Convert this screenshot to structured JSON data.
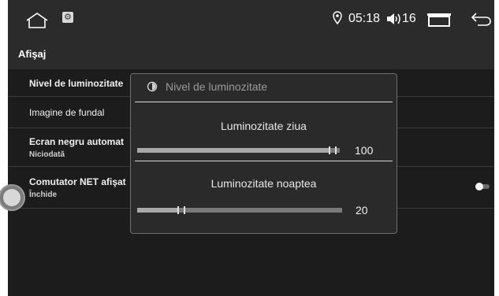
{
  "status_bar": {
    "home_icon": "home-icon",
    "settings_icon": "settings-gear-icon",
    "location_icon": "location-pin-icon",
    "time": "05:18",
    "volume_icon": "volume-icon",
    "volume": "16",
    "recent_icon": "recent-apps-icon",
    "back_icon": "back-arrow-icon"
  },
  "header": {
    "title": "Afişaj"
  },
  "settings_list": [
    {
      "title": "Nivel de luminozitate"
    },
    {
      "title": "Imagine de fundal"
    },
    {
      "title": "Ecran negru automat",
      "subtitle": "Niciodată"
    },
    {
      "title": "Comutator NET afişat",
      "subtitle": "Închide",
      "toggle_on": false
    }
  ],
  "dialog": {
    "icon": "brightness-icon",
    "title": "Nivel de luminozitate",
    "day": {
      "label": "Luminozitate ziua",
      "value": "100",
      "fraction": 1.0
    },
    "night": {
      "label": "Luminozitate noaptea",
      "value": "20",
      "fraction": 0.2
    }
  },
  "colors": {
    "background": "#1c1c1c",
    "bar": "#2b2b2b",
    "dialog": "#2a2a2a",
    "text": "#ffffff"
  }
}
